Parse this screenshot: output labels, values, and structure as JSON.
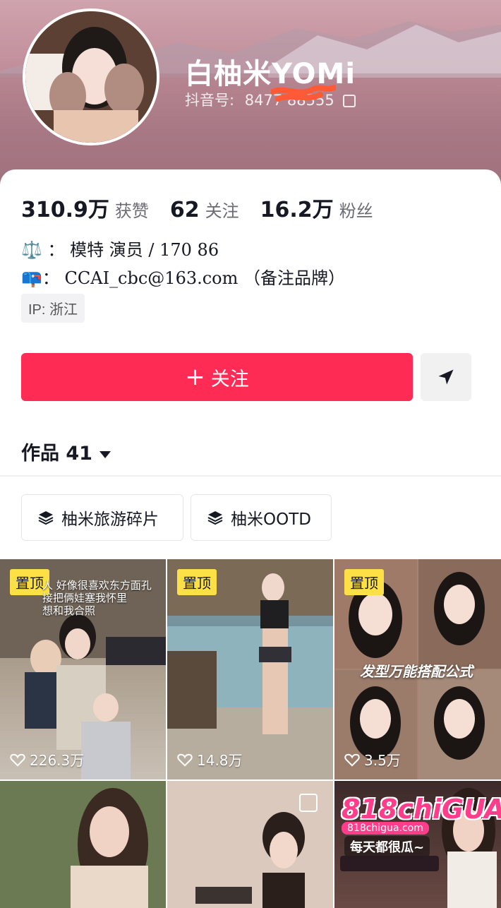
{
  "profile": {
    "display_name": "白柚米YOMi",
    "douyin_id_label": "抖音号:",
    "douyin_id_value": "8477 88555"
  },
  "stats": [
    {
      "value": "310.9万",
      "label": "获赞"
    },
    {
      "value": "62",
      "label": "关注"
    },
    {
      "value": "16.2万",
      "label": "粉丝"
    }
  ],
  "bio": {
    "line1": "⚖️ ： 模特 演员 / 170 86",
    "line2": "📪： CCAI_cbc@163.com （备注品牌）"
  },
  "ip_tag": "IP: 浙江",
  "actions": {
    "follow_label": "关注",
    "follow_plus": "+"
  },
  "works_tab": {
    "label": "作品 41"
  },
  "collections": [
    {
      "label": "柚米旅游碎片"
    },
    {
      "label": "柚米OOTD"
    }
  ],
  "grid": [
    {
      "pinned": "置顶",
      "likes": "226.3万",
      "caption": "人 好像很喜欢东方面孔\n接把俩娃塞我怀里\n想和我合照"
    },
    {
      "pinned": "置顶",
      "likes": "14.8万"
    },
    {
      "pinned": "置顶",
      "likes": "3.5万",
      "title": "发型万能搭配公式"
    },
    {},
    {},
    {
      "ad_big": "818chiGUA",
      "ad_small": "818chigua.com",
      "ad_slogan": "每天都很瓜~"
    }
  ],
  "colors": {
    "accent": "#fe2c55",
    "pin_badge": "#fce045"
  }
}
